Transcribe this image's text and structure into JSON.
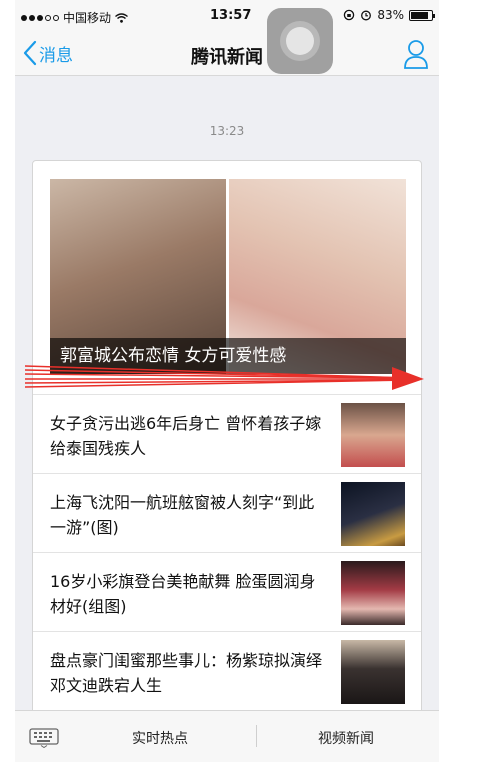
{
  "status_bar": {
    "carrier": "中国移动",
    "time": "13:57",
    "battery": "83%",
    "battery_level": 0.83
  },
  "nav": {
    "back_label": "消息",
    "title": "腾讯新闻"
  },
  "timestamp": "13:23",
  "card": {
    "hero_caption": "郭富城公布恋情 女方可爱性感",
    "news": [
      {
        "text": "女子贪污出逃6年后身亡 曾怀着孩子嫁给泰国残疾人"
      },
      {
        "text": "上海飞沈阳一航班舷窗被人刻字“到此一游”(图)"
      },
      {
        "text": "16岁小彩旗登台美艳献舞 脸蛋圆润身材好(组图)"
      },
      {
        "text": "盘点豪门闺蜜那些事儿：杨紫琼拟演绎邓文迪跌宕人生"
      }
    ]
  },
  "tabbar": {
    "tab1": "实时热点",
    "tab2": "视频新闻"
  },
  "colors": {
    "accent": "#1a9be8",
    "arrow": "#e8302a"
  }
}
